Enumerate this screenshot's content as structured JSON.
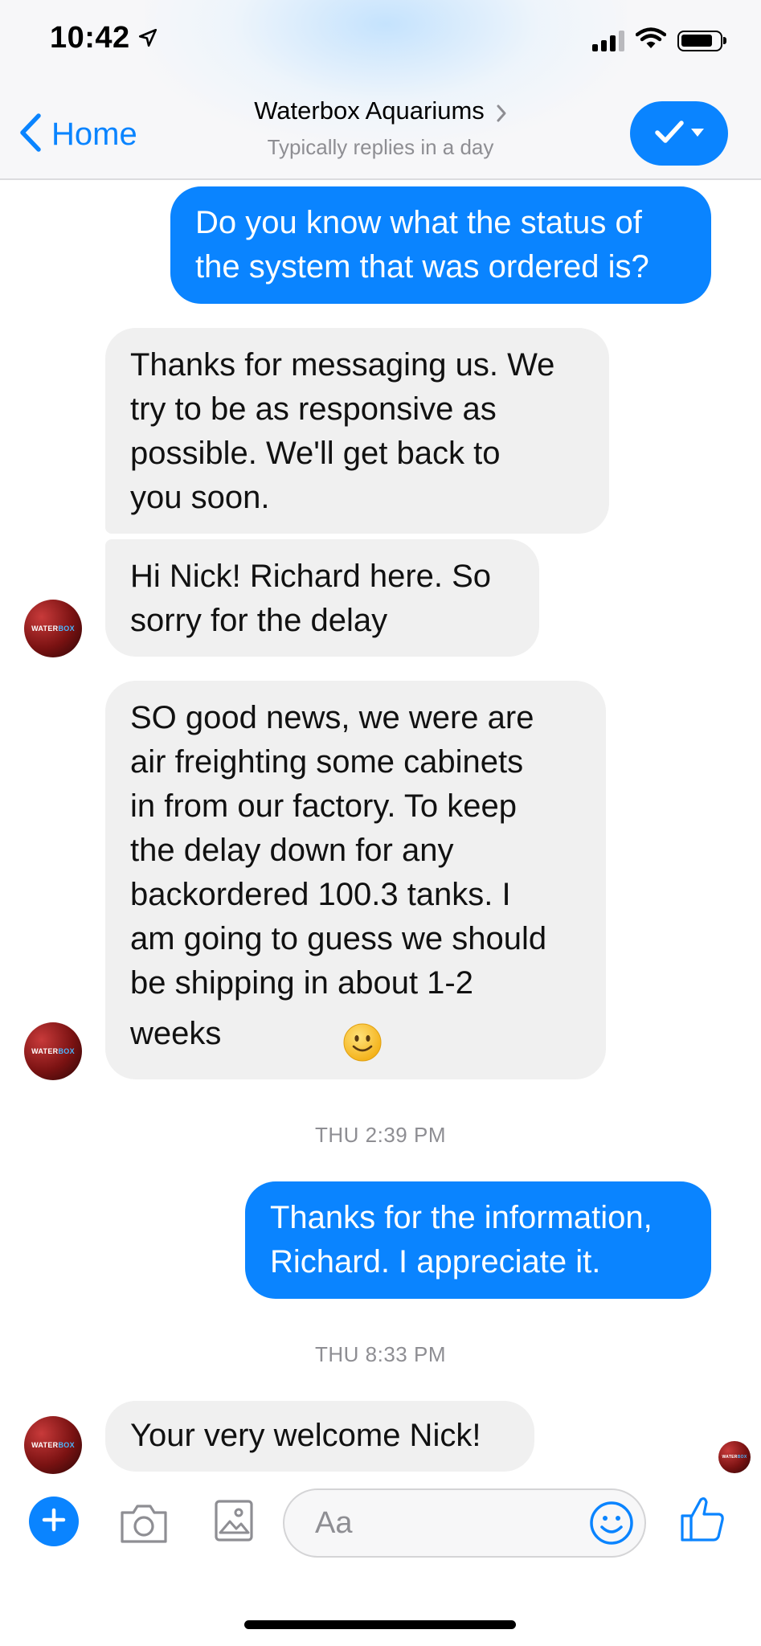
{
  "status_bar": {
    "time": "10:42"
  },
  "header": {
    "back_label": "Home",
    "title": "Waterbox Aquariums",
    "subtitle": "Typically replies in a day"
  },
  "avatar": {
    "logo_part1": "WATER",
    "logo_part2": "BOX"
  },
  "messages": [
    {
      "from": "me",
      "lines": [
        "Do you know what the status of",
        "the system that was ordered is?"
      ]
    },
    {
      "from": "them",
      "lines": [
        "Thanks for messaging us. We",
        "try to be as responsive as",
        "possible. We'll get back to",
        "you soon."
      ]
    },
    {
      "from": "them",
      "lines": [
        "Hi Nick! Richard here. So",
        "sorry for the delay"
      ]
    },
    {
      "from": "them",
      "lines": [
        "SO good news, we were are",
        "air freighting some cabinets",
        "in from our factory. To keep",
        "the delay down for any",
        "backordered 100.3 tanks. I",
        "am going to guess we should",
        "be shipping in about 1-2",
        "weeks"
      ],
      "emoji": "🙂"
    },
    {
      "timestamp": "THU 2:39 PM"
    },
    {
      "from": "me",
      "lines": [
        "Thanks for the information,",
        "Richard. I appreciate it."
      ]
    },
    {
      "timestamp": "THU 8:33 PM"
    },
    {
      "from": "them",
      "lines": [
        "Your very welcome Nick!"
      ]
    }
  ],
  "composer": {
    "placeholder": "Aa"
  },
  "colors": {
    "accent": "#0a84ff",
    "incoming_bubble": "#f0f0f0",
    "timestamp": "#8e8e93"
  }
}
